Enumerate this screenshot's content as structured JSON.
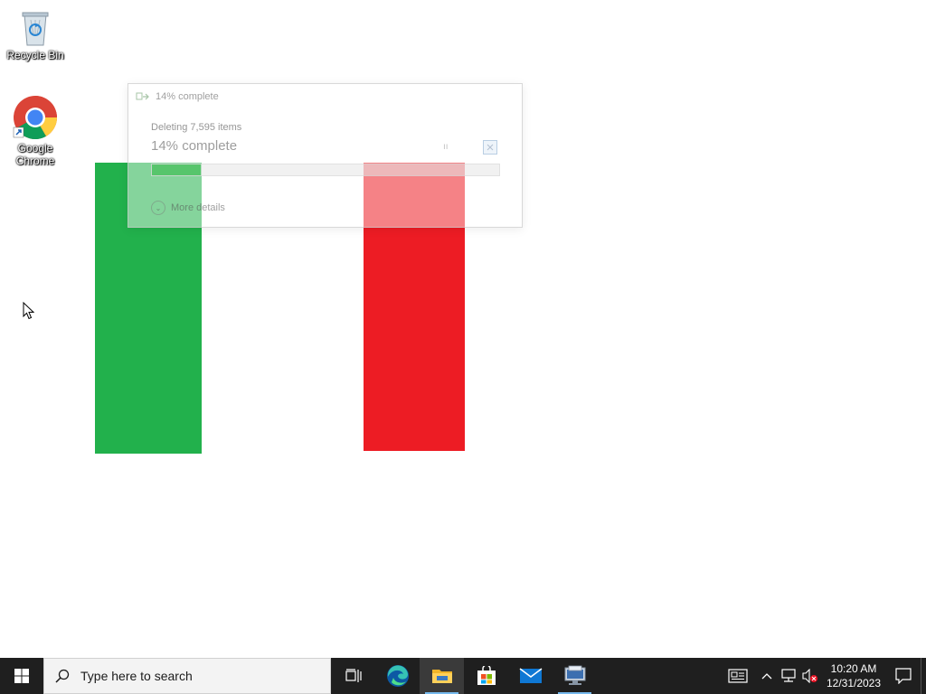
{
  "desktop": {
    "icons": [
      {
        "label": "Recycle Bin",
        "icon": "recycle-bin-icon"
      },
      {
        "label": "Google Chrome",
        "icon": "chrome-icon"
      }
    ],
    "bars": {
      "left_color": "#22b14c",
      "right_color": "#ed1c24"
    }
  },
  "dialog": {
    "title": "14% complete",
    "subtitle": "Deleting 7,595 items",
    "progress_text": "14% complete",
    "progress_fraction": 0.14,
    "more_details": "More details"
  },
  "taskbar": {
    "search_placeholder": "Type here to search",
    "apps": [
      {
        "name": "task-view",
        "icon": "task-view-icon"
      },
      {
        "name": "edge",
        "icon": "edge-icon"
      },
      {
        "name": "file-explorer",
        "icon": "folder-icon"
      },
      {
        "name": "store",
        "icon": "store-icon"
      },
      {
        "name": "mail",
        "icon": "mail-icon"
      },
      {
        "name": "network-app",
        "icon": "monitor-icon"
      }
    ],
    "clock": {
      "time": "10:20 AM",
      "date": "12/31/2023"
    }
  },
  "colors": {
    "taskbar_bg": "#1f1f1f",
    "accent": "#76b9ed",
    "progress_green": "#06b025"
  }
}
